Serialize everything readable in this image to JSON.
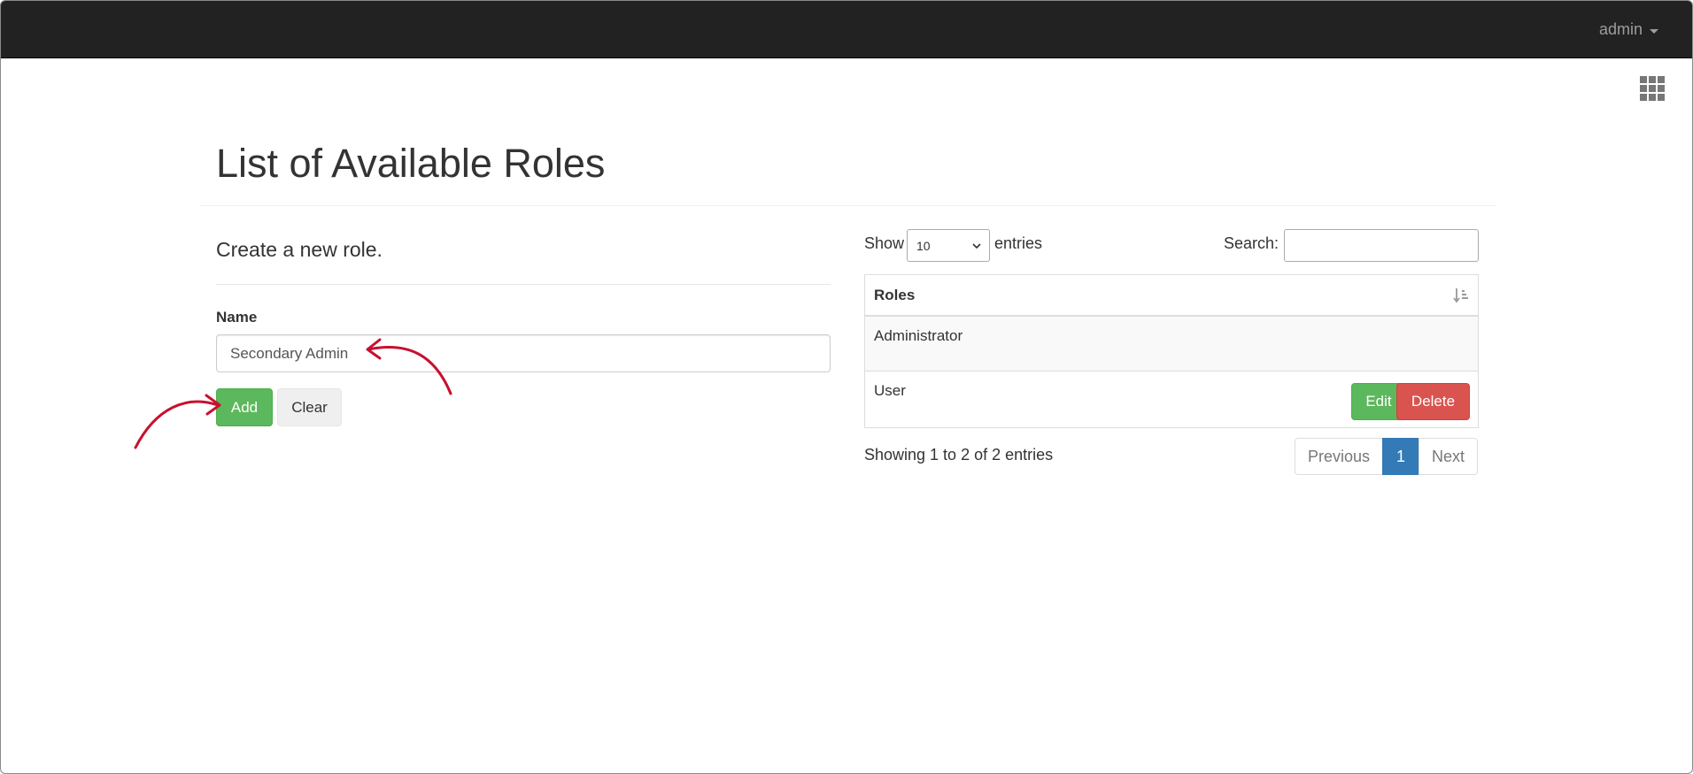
{
  "navbar": {
    "user_label": "admin"
  },
  "icons": {
    "apps": "grid-apps-icon",
    "user_caret": "caret-down-icon",
    "sort": "sort-alpha-icon",
    "select_chevron": "chevron-down-icon"
  },
  "page": {
    "title": "List of Available Roles"
  },
  "form": {
    "heading": "Create a new role.",
    "name_label": "Name",
    "name_value": "Secondary Admin",
    "add_label": "Add",
    "clear_label": "Clear"
  },
  "datatable": {
    "show_label": "Show",
    "page_length": "10",
    "entries_label": "entries",
    "search_label": "Search:",
    "search_value": "",
    "column_header": "Roles",
    "rows": [
      {
        "role": "Administrator"
      },
      {
        "role": "User",
        "edit_label": "Edit",
        "delete_label": "Delete"
      }
    ],
    "info": "Showing 1 to 2 of 2 entries",
    "pagination": {
      "previous": "Previous",
      "current": "1",
      "next": "Next"
    }
  },
  "colors": {
    "navbar": "#222222",
    "success": "#5cb85c",
    "danger": "#d9534f",
    "primary": "#337ab7",
    "annotation_arrow": "#c8102e"
  }
}
